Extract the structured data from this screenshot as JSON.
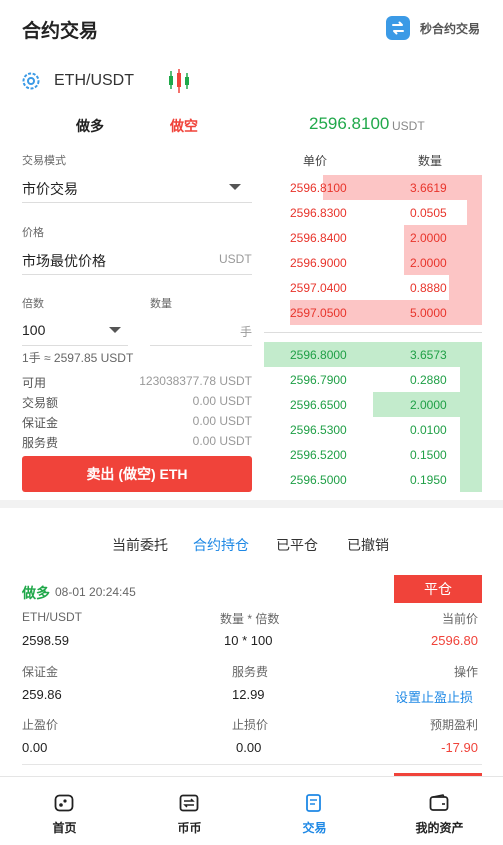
{
  "header": {
    "title": "合约交易",
    "swap_label": "秒合约交易"
  },
  "pair": {
    "name": "ETH/USDT"
  },
  "trade": {
    "tab_long": "做多",
    "tab_short": "做空",
    "last_price": "2596.8100",
    "last_price_unit": "USDT",
    "mode_label": "交易模式",
    "mode_value": "市价交易",
    "price_label": "价格",
    "price_value": "市场最优价格",
    "price_unit": "USDT",
    "leverage_label": "倍数",
    "leverage_value": "100",
    "qty_label": "数量",
    "qty_unit": "手",
    "lot_hint": "1手 ≈ 2597.85 USDT",
    "info": [
      {
        "label": "可用",
        "value": "123038377.78 USDT"
      },
      {
        "label": "交易额",
        "value": "0.00 USDT"
      },
      {
        "label": "保证金",
        "value": "0.00 USDT"
      },
      {
        "label": "服务费",
        "value": "0.00 USDT"
      }
    ],
    "sell_button": "卖出 (做空) ETH"
  },
  "orderbook": {
    "head_price": "单价",
    "head_qty": "数量",
    "asks": [
      {
        "price": "2596.8100",
        "qty": "3.6619",
        "depth": 0.73
      },
      {
        "price": "2596.8300",
        "qty": "0.0505",
        "depth": 0.07
      },
      {
        "price": "2596.8400",
        "qty": "2.0000",
        "depth": 0.36
      },
      {
        "price": "2596.9000",
        "qty": "2.0000",
        "depth": 0.36
      },
      {
        "price": "2597.0400",
        "qty": "0.8880",
        "depth": 0.15
      },
      {
        "price": "2597.0500",
        "qty": "5.0000",
        "depth": 0.88
      }
    ],
    "bids": [
      {
        "price": "2596.8000",
        "qty": "3.6573",
        "depth": 1.0
      },
      {
        "price": "2596.7900",
        "qty": "0.2880",
        "depth": 0.1
      },
      {
        "price": "2596.6500",
        "qty": "2.0000",
        "depth": 0.5
      },
      {
        "price": "2596.5300",
        "qty": "0.0100",
        "depth": 0.1
      },
      {
        "price": "2596.5200",
        "qty": "0.1500",
        "depth": 0.1
      },
      {
        "price": "2596.5000",
        "qty": "0.1950",
        "depth": 0.1
      }
    ]
  },
  "positions": {
    "tabs": [
      "当前委托",
      "合约持仓",
      "已平仓",
      "已撤销"
    ],
    "active_tab": 1,
    "item": {
      "direction": "做多",
      "time": "08-01 20:24:45",
      "close_button": "平仓",
      "pair_label": "ETH/USDT",
      "open_price": "2598.59",
      "qty_label": "数量 * 倍数",
      "qty_value": "10 * 100",
      "cur_label": "当前价",
      "cur_value": "2596.80",
      "margin_label": "保证金",
      "margin_value": "259.86",
      "fee_label": "服务费",
      "fee_value": "12.99",
      "op_label": "操作",
      "op_value": "设置止盈止损",
      "tp_label": "止盈价",
      "tp_value": "0.00",
      "sl_label": "止损价",
      "sl_value": "0.00",
      "pnl_label": "预期盈利",
      "pnl_value": "-17.90"
    }
  },
  "nav": [
    {
      "label": "首页",
      "icon": "home-icon"
    },
    {
      "label": "币币",
      "icon": "exchange-icon"
    },
    {
      "label": "交易",
      "icon": "trade-icon"
    },
    {
      "label": "我的资产",
      "icon": "wallet-icon"
    }
  ],
  "colors": {
    "up": "#20a84a",
    "down": "#f0433a",
    "accent": "#1e88e5"
  }
}
